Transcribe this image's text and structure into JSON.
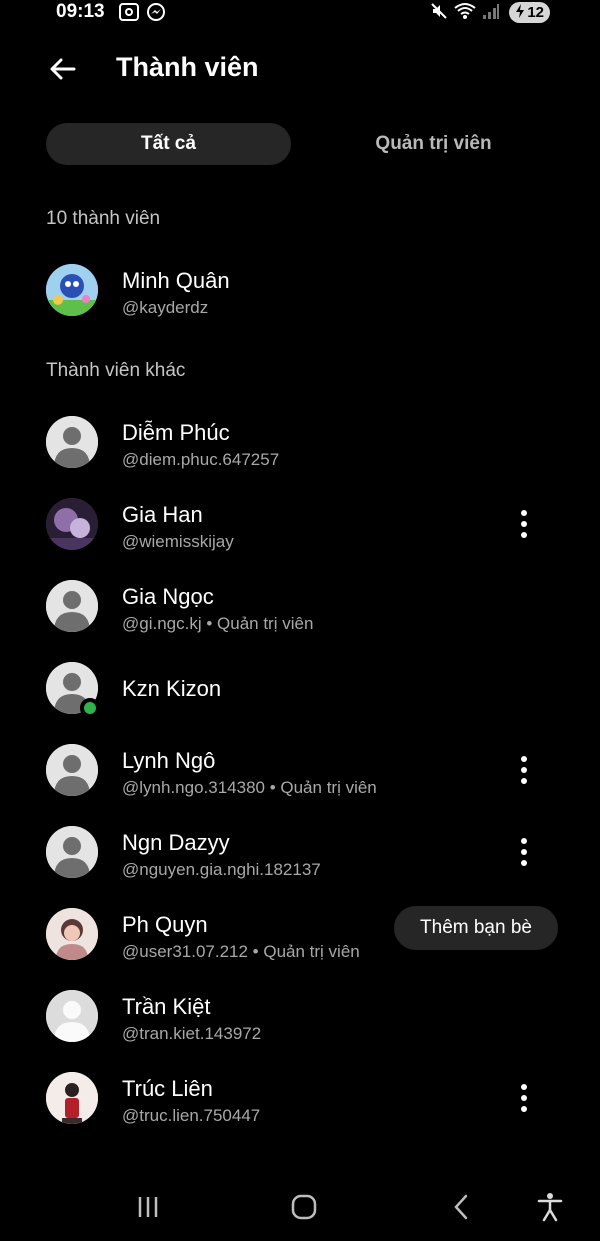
{
  "status_bar": {
    "time": "09:13",
    "battery": "12",
    "icons": [
      "screenshot-icon",
      "messenger-icon",
      "mute-icon",
      "wifi-icon",
      "signal-icon",
      "battery-charging-icon"
    ]
  },
  "header": {
    "title": "Thành viên"
  },
  "tabs": [
    {
      "label": "Tất cả",
      "selected": true
    },
    {
      "label": "Quản trị viên",
      "selected": false
    }
  ],
  "member_count": "10 thành viên",
  "owner": {
    "name": "Minh Quân",
    "username": "@kayderdz"
  },
  "other_members_label": "Thành viên khác",
  "members": [
    {
      "name": "Diễm Phúc",
      "sub": "@diem.phuc.647257"
    },
    {
      "name": "Gia Han",
      "sub": "@wiemisskijay"
    },
    {
      "name": "Gia Ngọc",
      "sub": "@gi.ngc.kj • Quản trị viên"
    },
    {
      "name": "Kzn Kizon",
      "sub": ""
    },
    {
      "name": "Lynh Ngô",
      "sub": "@lynh.ngo.314380 • Quản trị viên"
    },
    {
      "name": "Ngn Dazyy",
      "sub": "@nguyen.gia.nghi.182137"
    },
    {
      "name": "Ph Quyn",
      "sub": "@user31.07.212 • Quản trị viên"
    },
    {
      "name": "Trần Kiệt",
      "sub": "@tran.kiet.143972"
    },
    {
      "name": "Trúc Liên",
      "sub": "@truc.lien.750447"
    }
  ],
  "add_friend_label": "Thêm bạn bè",
  "colors": {
    "background": "#000000",
    "pill": "#262626",
    "online": "#2fb34a",
    "muted_text": "#a8a8a8"
  },
  "nav_bar": {
    "icons": [
      "recent-apps-icon",
      "home-icon",
      "back-icon",
      "accessibility-icon"
    ]
  }
}
